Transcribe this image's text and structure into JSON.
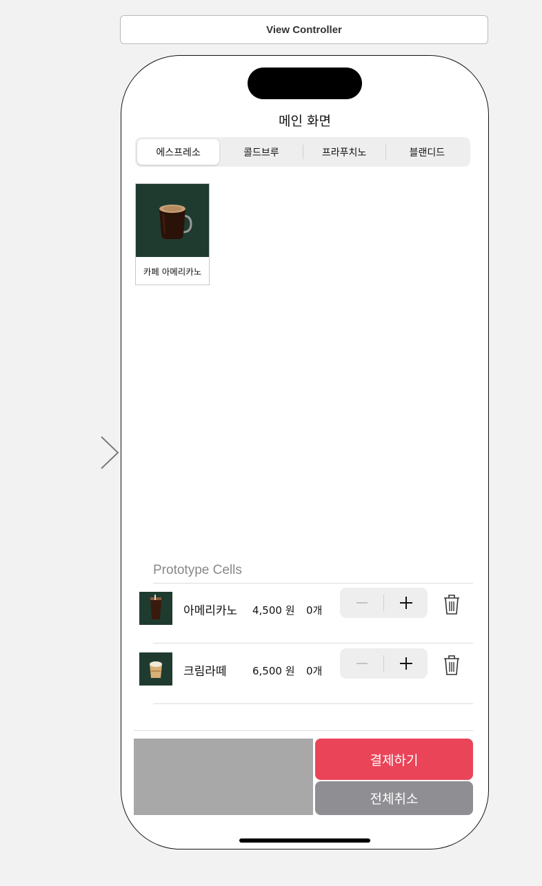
{
  "scene": {
    "title": "View Controller"
  },
  "nav": {
    "title": "메인 화면"
  },
  "segments": [
    {
      "label": "에스프레소",
      "selected": true
    },
    {
      "label": "콜드브루",
      "selected": false
    },
    {
      "label": "프라푸치노",
      "selected": false
    },
    {
      "label": "블랜디드",
      "selected": false
    }
  ],
  "menu_items": [
    {
      "name": "카페 아메리카노",
      "image": "coffee-mug-image"
    }
  ],
  "prototype_section": {
    "header": "Prototype Cells"
  },
  "cart_items": [
    {
      "name": "아메리카노",
      "price": "4,500 원",
      "quantity": "0개",
      "image": "iced-coffee-image"
    },
    {
      "name": "크림라떼",
      "price": "6,500 원",
      "quantity": "0개",
      "image": "cream-latte-image"
    }
  ],
  "actions": {
    "pay_label": "결제하기",
    "cancel_all_label": "전체취소"
  },
  "colors": {
    "pay_button": "#ea4459",
    "cancel_button": "#8e8e93",
    "image_background": "#1f3b30",
    "bottom_panel": "#a8a8a8"
  }
}
